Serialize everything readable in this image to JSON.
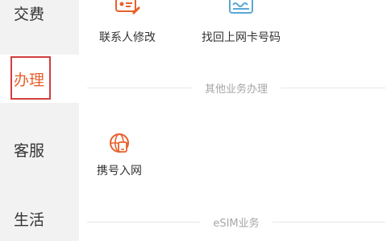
{
  "sidebar": {
    "items": [
      {
        "label": "交费"
      },
      {
        "label": "办理"
      },
      {
        "label": "客服"
      },
      {
        "label": "生活"
      }
    ]
  },
  "services_top": [
    {
      "label": "联系人修改",
      "icon": "contact-edit-icon"
    },
    {
      "label": "找回上网卡号码",
      "icon": "sim-card-icon"
    }
  ],
  "sections": [
    {
      "title": "其他业务办理",
      "items": [
        {
          "label": "携号入网",
          "icon": "number-portability-icon"
        }
      ]
    },
    {
      "title": "eSIM业务",
      "items": []
    }
  ],
  "colors": {
    "accent": "#e8612c",
    "sim_blue": "#5aa7d6",
    "sidebar_bg": "#f2f2f2",
    "highlight_box": "#d23f3f"
  }
}
